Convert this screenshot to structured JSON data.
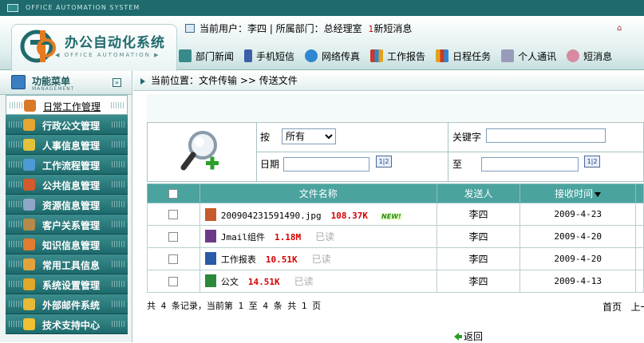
{
  "app": {
    "system_banner": "OFFICE AUTOMATION SYSTEM",
    "title": "办公自动化系统",
    "subtitle": "◀ OFFICE AUTOMATION ▶"
  },
  "user": {
    "info": "当前用户：李四 | 所属部门：总经理室",
    "sms_count": "1",
    "sms_label": "新短消息",
    "corner_icon": "⌂"
  },
  "topnav": [
    {
      "label": "部门新闻",
      "icon": "news-icon",
      "color": "#3a8a8a"
    },
    {
      "label": "手机短信",
      "icon": "phone-icon",
      "color": "#3b5fa8"
    },
    {
      "label": "网络传真",
      "icon": "fax-icon",
      "color": "#2f86d1"
    },
    {
      "label": "工作报告",
      "icon": "report-icon",
      "color": "#c8392b"
    },
    {
      "label": "日程任务",
      "icon": "calendar-icon",
      "color": "#e2a21a"
    },
    {
      "label": "个人通讯",
      "icon": "contacts-icon",
      "color": "#7a7a9a"
    },
    {
      "label": "短消息",
      "icon": "message-icon",
      "color": "#d98aa0"
    }
  ],
  "sidebar": {
    "title": "功能菜单",
    "subtitle": "MANAGEMENT",
    "collapse_icon": "»",
    "items": [
      {
        "label": "日常工作管理",
        "color": "#d97a2b",
        "active": true
      },
      {
        "label": "行政公文管理",
        "color": "#e6a531"
      },
      {
        "label": "人事信息管理",
        "color": "#e3c23a"
      },
      {
        "label": "工作流程管理",
        "color": "#4d9bd6"
      },
      {
        "label": "公共信息管理",
        "color": "#d35a2a"
      },
      {
        "label": "资源信息管理",
        "color": "#8fa7c7"
      },
      {
        "label": "客户关系管理",
        "color": "#b68a4a"
      },
      {
        "label": "知识信息管理",
        "color": "#e17c2e"
      },
      {
        "label": "常用工具信息",
        "color": "#e3a33c"
      },
      {
        "label": "系统设置管理",
        "color": "#e1a72b"
      },
      {
        "label": "外部邮件系统",
        "color": "#e6b936"
      },
      {
        "label": "技术支持中心",
        "color": "#f0c030"
      }
    ]
  },
  "breadcrumb": "当前位置：文件传输 >> 传送文件",
  "search": {
    "by_label": "按",
    "by_value": "所有",
    "keyword_label": "关键字",
    "keyword_value": "",
    "date_label": "日期",
    "date_from": "",
    "to_label": "至",
    "date_to": "",
    "cal_icon": "1|2"
  },
  "table": {
    "headers": [
      "文件名称",
      "发送人",
      "接收时间"
    ],
    "rows": [
      {
        "filename": "200904231591490.jpg",
        "size": "108.37K",
        "status": "",
        "new_badge": "NEW!",
        "sender": "李四",
        "date": "2009-4-23",
        "icon_color": "#c65a2a"
      },
      {
        "filename": "Jmail组件",
        "size": "1.18M",
        "status": "已读",
        "new_badge": "",
        "sender": "李四",
        "date": "2009-4-20",
        "icon_color": "#6a3a8a"
      },
      {
        "filename": "工作报表",
        "size": "10.51K",
        "status": "已读",
        "new_badge": "",
        "sender": "李四",
        "date": "2009-4-20",
        "icon_color": "#2a5aa8"
      },
      {
        "filename": "公文",
        "size": "14.51K",
        "status": "已读",
        "new_badge": "",
        "sender": "李四",
        "date": "2009-4-13",
        "icon_color": "#2a8a3a"
      }
    ]
  },
  "footer": {
    "summary": "共 4 条记录，当前第 1 至 4 条 共 1 页",
    "first_page": "首页",
    "prev_page": "上一",
    "back": "返回"
  }
}
